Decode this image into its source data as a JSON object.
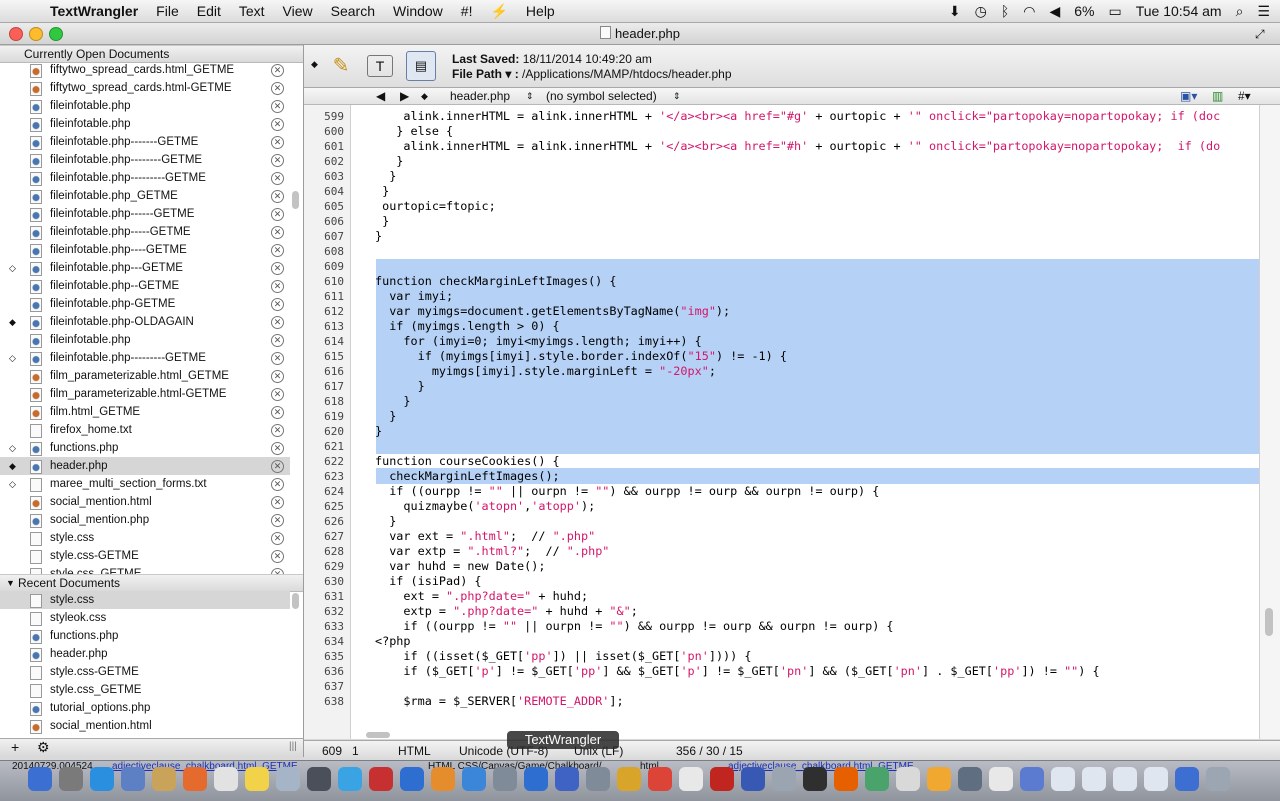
{
  "menubar": {
    "app": "TextWrangler",
    "menus": [
      "File",
      "Edit",
      "Text",
      "View",
      "Search",
      "Window",
      "#!",
      "Help"
    ],
    "battery": "6%",
    "clock": "Tue 10:54 am"
  },
  "window": {
    "title": "header.php"
  },
  "sidebar": {
    "open_header": "Currently Open Documents",
    "recent_header": "Recent Documents",
    "open_docs": [
      {
        "name": "fiftytwo_spread_cards.html_GETME",
        "mark": ""
      },
      {
        "name": "fiftytwo_spread_cards.html-GETME",
        "mark": ""
      },
      {
        "name": "fileinfotable.php",
        "mark": ""
      },
      {
        "name": "fileinfotable.php",
        "mark": ""
      },
      {
        "name": "fileinfotable.php-------GETME",
        "mark": ""
      },
      {
        "name": "fileinfotable.php--------GETME",
        "mark": ""
      },
      {
        "name": "fileinfotable.php---------GETME",
        "mark": ""
      },
      {
        "name": "fileinfotable.php_GETME",
        "mark": ""
      },
      {
        "name": "fileinfotable.php------GETME",
        "mark": ""
      },
      {
        "name": "fileinfotable.php-----GETME",
        "mark": ""
      },
      {
        "name": "fileinfotable.php----GETME",
        "mark": ""
      },
      {
        "name": "fileinfotable.php---GETME",
        "mark": "◇"
      },
      {
        "name": "fileinfotable.php--GETME",
        "mark": ""
      },
      {
        "name": "fileinfotable.php-GETME",
        "mark": ""
      },
      {
        "name": "fileinfotable.php-OLDAGAIN",
        "mark": "◆"
      },
      {
        "name": "fileinfotable.php",
        "mark": ""
      },
      {
        "name": "fileinfotable.php---------GETME",
        "mark": "◇"
      },
      {
        "name": "film_parameterizable.html_GETME",
        "mark": ""
      },
      {
        "name": "film_parameterizable.html-GETME",
        "mark": ""
      },
      {
        "name": "film.html_GETME",
        "mark": ""
      },
      {
        "name": "firefox_home.txt",
        "mark": ""
      },
      {
        "name": "functions.php",
        "mark": "◇"
      },
      {
        "name": "header.php",
        "mark": "◆"
      },
      {
        "name": "maree_multi_section_forms.txt",
        "mark": "◇"
      },
      {
        "name": "social_mention.html",
        "mark": ""
      },
      {
        "name": "social_mention.php",
        "mark": ""
      },
      {
        "name": "style.css",
        "mark": ""
      },
      {
        "name": "style.css-GETME",
        "mark": ""
      },
      {
        "name": "style.css_GETME",
        "mark": ""
      }
    ],
    "recent_docs": [
      "style.css",
      "styleok.css",
      "functions.php",
      "header.php",
      "style.css-GETME",
      "style.css_GETME",
      "tutorial_options.php",
      "social_mention.html"
    ],
    "add_label": "+",
    "gear_label": "⚙"
  },
  "toolbar": {
    "last_saved_label": "Last Saved:",
    "last_saved_value": "18/11/2014 10:49:20 am",
    "file_path_label": "File Path ▾ :",
    "file_path_value": "/Applications/MAMP/htdocs/header.php"
  },
  "navbar": {
    "file": "header.php",
    "symbol": "(no symbol selected)"
  },
  "code": {
    "lines": [
      {
        "n": "599",
        "t": "    alink.innerHTML = alink.innerHTML + '</a><br><a href=\"#g' + ourtopic + '\" onclick=\"partopokay=nopartopokay; if (doc"
      },
      {
        "n": "600",
        "t": "   } else {"
      },
      {
        "n": "601",
        "t": "    alink.innerHTML = alink.innerHTML + '</a><br><a href=\"#h' + ourtopic + '\" onclick=\"partopokay=nopartopokay;  if (do"
      },
      {
        "n": "602",
        "t": "   }"
      },
      {
        "n": "603",
        "t": "  }"
      },
      {
        "n": "604",
        "t": " }"
      },
      {
        "n": "605",
        "t": " ourtopic=ftopic;"
      },
      {
        "n": "606",
        "t": " }"
      },
      {
        "n": "607",
        "t": "}"
      },
      {
        "n": "608",
        "t": ""
      },
      {
        "n": "609",
        "t": ""
      },
      {
        "n": "610",
        "t": "function checkMarginLeftImages() {"
      },
      {
        "n": "611",
        "t": "  var imyi;"
      },
      {
        "n": "612",
        "t": "  var myimgs=document.getElementsByTagName(\"img\");"
      },
      {
        "n": "613",
        "t": "  if (myimgs.length > 0) {"
      },
      {
        "n": "614",
        "t": "    for (imyi=0; imyi<myimgs.length; imyi++) {"
      },
      {
        "n": "615",
        "t": "      if (myimgs[imyi].style.border.indexOf(\"15\") != -1) {"
      },
      {
        "n": "616",
        "t": "        myimgs[imyi].style.marginLeft = \"-20px\";"
      },
      {
        "n": "617",
        "t": "      }"
      },
      {
        "n": "618",
        "t": "    }"
      },
      {
        "n": "619",
        "t": "  }"
      },
      {
        "n": "620",
        "t": "}"
      },
      {
        "n": "621",
        "t": ""
      },
      {
        "n": "622",
        "t": "function courseCookies() {"
      },
      {
        "n": "623",
        "t": "  checkMarginLeftImages();"
      },
      {
        "n": "624",
        "t": "  if ((ourpp != \"\" || ourpn != \"\") && ourpp != ourp && ourpn != ourp) {"
      },
      {
        "n": "625",
        "t": "    quizmaybe('atopn','atopp');"
      },
      {
        "n": "626",
        "t": "  }"
      },
      {
        "n": "627",
        "t": "  var ext = \".html\";  // \".php\""
      },
      {
        "n": "628",
        "t": "  var extp = \".html?\";  // \".php\""
      },
      {
        "n": "629",
        "t": "  var huhd = new Date();"
      },
      {
        "n": "630",
        "t": "  if (isiPad) {"
      },
      {
        "n": "631",
        "t": "    ext = \".php?date=\" + huhd;"
      },
      {
        "n": "632",
        "t": "    extp = \".php?date=\" + huhd + \"&\";"
      },
      {
        "n": "633",
        "t": "    if ((ourpp != \"\" || ourpn != \"\") && ourpp != ourp && ourpn != ourp) {"
      },
      {
        "n": "634",
        "t": "<?php"
      },
      {
        "n": "635",
        "t": "    if ((isset($_GET['pp']) || isset($_GET['pn']))) {"
      },
      {
        "n": "636",
        "t": "    if ($_GET['p'] != $_GET['pp'] && $_GET['p'] != $_GET['pn'] && ($_GET['pn'] . $_GET['pp']) != \"\") {"
      },
      {
        "n": "637",
        "t": ""
      },
      {
        "n": "638",
        "t": "    $rma = $_SERVER['REMOTE_ADDR'];"
      }
    ]
  },
  "status": {
    "line": "609",
    "col": "1",
    "language": "HTML",
    "encoding": "Unicode (UTF-8)",
    "line_endings": "Unix (LF)",
    "stats": "356 / 30 / 15"
  },
  "tooltip": "TextWrangler",
  "dock": {
    "label_left": "20140729.004524",
    "label_link1": "adjectiveclause_chalkboard.html_GETME",
    "label_mid": "HTML CSS/Canvas/Game/Chalkboard/",
    "label_html": "html",
    "label_link2": "adjectiveclause_chalkboard.html_GETME"
  }
}
